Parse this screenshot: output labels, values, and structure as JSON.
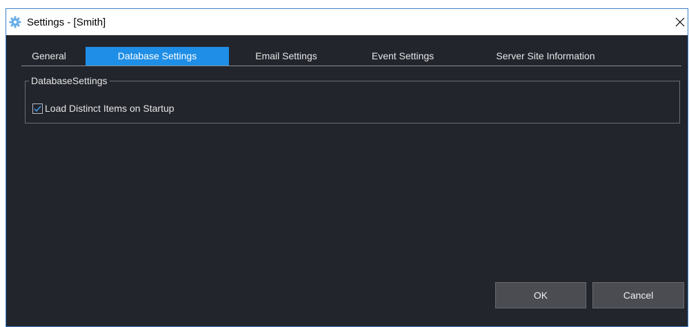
{
  "window": {
    "title": "Settings - [Smith]",
    "icon": "gear-icon",
    "close_glyph": "✕"
  },
  "tabs": [
    {
      "label": "General",
      "active": false
    },
    {
      "label": "Database Settings",
      "active": true
    },
    {
      "label": "Email Settings",
      "active": false
    },
    {
      "label": "Event Settings",
      "active": false
    },
    {
      "label": "Server Site Information",
      "active": false
    }
  ],
  "database_group": {
    "legend": "DatabaseSettings",
    "load_distinct": {
      "label": "Load Distinct Items on Startup",
      "checked": true
    }
  },
  "buttons": {
    "ok": "OK",
    "cancel": "Cancel"
  },
  "colors": {
    "background": "#23252d",
    "accent": "#1e8ee6",
    "button": "#4a4c52"
  }
}
